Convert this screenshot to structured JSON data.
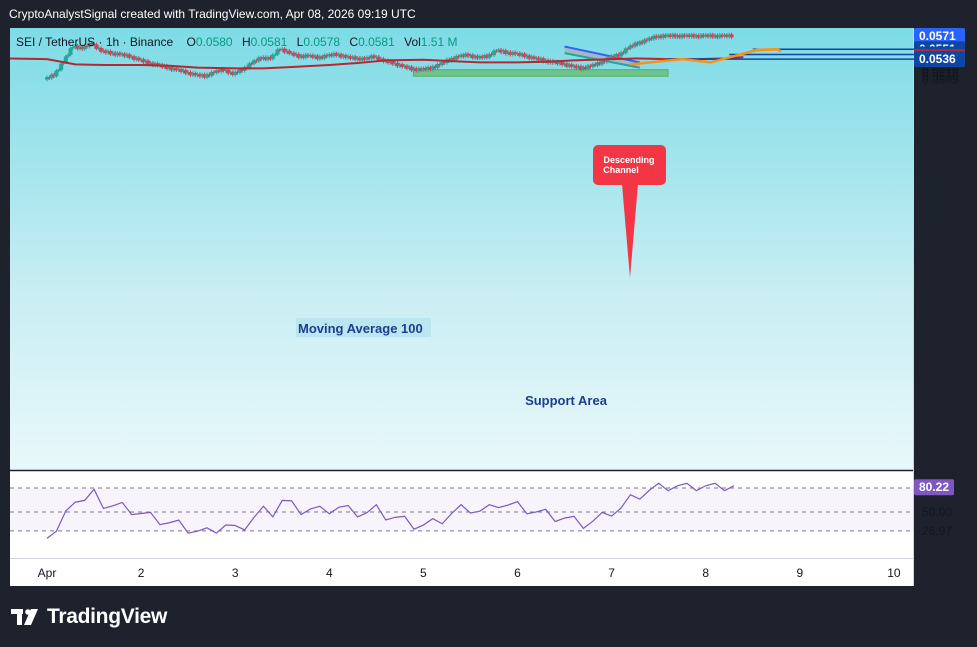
{
  "header": {
    "attribution": "CryptoAnalystSignal created with TradingView.com, Apr 08, 2026 09:19 UTC"
  },
  "legend": {
    "symbol": "SEI / TetherUS · 1h · Binance",
    "o_label": "O",
    "o_value": "0.0580",
    "h_label": "H",
    "h_value": "0.0581",
    "l_label": "L",
    "l_value": "0.0578",
    "c_label": "C",
    "c_value": "0.0581",
    "vol_label": "Vol",
    "vol_value": "1.51 M"
  },
  "annotations": {
    "ma_label": "Moving Average 100",
    "support_label": "Support Area",
    "channel_label_line1": "Descending",
    "channel_label_line2": "Channel"
  },
  "price_scale": {
    "ticks": [
      "0.0565",
      "0.0560",
      "0.0555",
      "0.0550",
      "0.0545",
      "0.0540",
      "0.0530",
      "0.0525",
      "0.0520",
      "0.0515",
      "0.0510",
      "0.0505"
    ],
    "badges": [
      {
        "label": "0.0571",
        "color": "#2962ff",
        "kind": "last"
      },
      {
        "label": "0.0551",
        "color": "#0d47a1",
        "kind": "line"
      },
      {
        "label": "0.0543",
        "color": "#0d47a1",
        "kind": "line"
      },
      {
        "label": "0.0539",
        "color": "#b22833",
        "kind": "ma"
      },
      {
        "label": "0.0536",
        "color": "#0d47a1",
        "kind": "line"
      }
    ]
  },
  "rsi_scale": {
    "ticks": [
      "79.25",
      "50.00",
      "26.97"
    ],
    "badge": {
      "label": "80.22",
      "color": "#7e57c2"
    }
  },
  "time_axis": {
    "labels": [
      "Apr",
      "2",
      "3",
      "4",
      "5",
      "6",
      "7",
      "8",
      "9",
      "10"
    ]
  },
  "brand": {
    "name": "TradingView"
  },
  "colors": {
    "up": "#26a69a",
    "down": "#e53950",
    "ma": "#b22833",
    "rsi": "#7e57c2",
    "projection": "#f7931a",
    "levels": "#0d47a1",
    "support": "#66bb6a",
    "bg_top": "#00bcd4"
  },
  "chart_data": {
    "type": "line",
    "symbol": "SEI / TetherUS",
    "timeframe": "1h",
    "x_time": [
      "Apr 1",
      "Apr 2",
      "Apr 3",
      "Apr 4",
      "Apr 5",
      "Apr 6",
      "Apr 7",
      "Apr 8",
      "Apr 9",
      "Apr 10"
    ],
    "series": [
      {
        "name": "Moving Average 100",
        "x_day": [
          1.0,
          1.3,
          1.6,
          2.0,
          2.3,
          2.6,
          3.0,
          3.3,
          3.6,
          4.0,
          4.3,
          4.6,
          5.0,
          5.3,
          5.6,
          6.0,
          6.3,
          6.6,
          7.0,
          7.3,
          7.6,
          7.9,
          8.2,
          8.4
        ],
        "values": [
          0.0536,
          0.0528,
          0.0527,
          0.0527,
          0.0526,
          0.0523,
          0.0522,
          0.0522,
          0.0524,
          0.0527,
          0.053,
          0.0534,
          0.0535,
          0.0533,
          0.0531,
          0.0531,
          0.0532,
          0.0534,
          0.0536,
          0.0537,
          0.0536,
          0.0536,
          0.0537,
          0.0539
        ]
      }
    ],
    "price_path": {
      "x_day": [
        1.0,
        1.1,
        1.2,
        1.3,
        1.4,
        1.5,
        1.6,
        1.7,
        1.8,
        1.9,
        2.0,
        2.1,
        2.2,
        2.3,
        2.4,
        2.5,
        2.6,
        2.7,
        2.8,
        2.9,
        3.0,
        3.1,
        3.2,
        3.3,
        3.4,
        3.5,
        3.6,
        3.7,
        3.8,
        3.9,
        4.0,
        4.1,
        4.2,
        4.3,
        4.4,
        4.5,
        4.6,
        4.7,
        4.8,
        4.9,
        5.0,
        5.1,
        5.2,
        5.3,
        5.4,
        5.5,
        5.6,
        5.7,
        5.8,
        5.9,
        6.0,
        6.1,
        6.2,
        6.3,
        6.4,
        6.5,
        6.6,
        6.7,
        6.8,
        6.9,
        7.0,
        7.1,
        7.2,
        7.3,
        7.4,
        7.5,
        7.6,
        7.7,
        7.8,
        7.9,
        8.0,
        8.1,
        8.2,
        8.3
      ],
      "close": [
        0.0505,
        0.0512,
        0.0532,
        0.0556,
        0.0552,
        0.056,
        0.0548,
        0.0545,
        0.0543,
        0.054,
        0.0535,
        0.053,
        0.0527,
        0.0523,
        0.052,
        0.0516,
        0.0512,
        0.051,
        0.0516,
        0.052,
        0.0513,
        0.052,
        0.053,
        0.0538,
        0.0537,
        0.0552,
        0.0545,
        0.054,
        0.0541,
        0.0538,
        0.0541,
        0.0543,
        0.0539,
        0.0537,
        0.0536,
        0.054,
        0.0533,
        0.053,
        0.0525,
        0.0521,
        0.052,
        0.0522,
        0.0528,
        0.0535,
        0.054,
        0.0542,
        0.0538,
        0.054,
        0.0549,
        0.0546,
        0.0544,
        0.0541,
        0.0537,
        0.0534,
        0.0531,
        0.0529,
        0.0525,
        0.0522,
        0.0525,
        0.053,
        0.0538,
        0.0542,
        0.0553,
        0.056,
        0.0565,
        0.057,
        0.0571,
        0.0571,
        0.0571,
        0.0571,
        0.0571,
        0.0571,
        0.0571,
        0.0571
      ]
    },
    "rsi": {
      "levels": [
        79.25,
        50.0,
        26.97
      ],
      "last": 80.22
    },
    "horizontal_levels": [
      0.0551,
      0.0543,
      0.0536
    ],
    "support_area": [
      0.0513,
      0.0517
    ],
    "ylim": [
      0.0503,
      0.0573
    ]
  }
}
